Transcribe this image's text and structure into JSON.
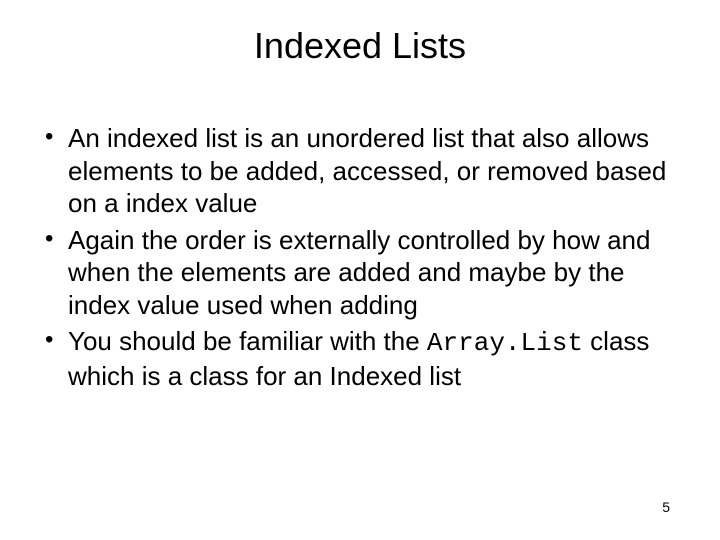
{
  "slide": {
    "title": "Indexed Lists",
    "bullets": [
      {
        "text": "An indexed list is an unordered list that also allows elements to be added, accessed, or removed based on a index value"
      },
      {
        "text": "Again the order is externally controlled by how and when the elements are added and maybe by the index value used when adding"
      },
      {
        "prefix": "You should be familiar with the ",
        "code": "Array.List",
        "suffix": " class which is a class for an Indexed list"
      }
    ],
    "page_number": "5"
  }
}
